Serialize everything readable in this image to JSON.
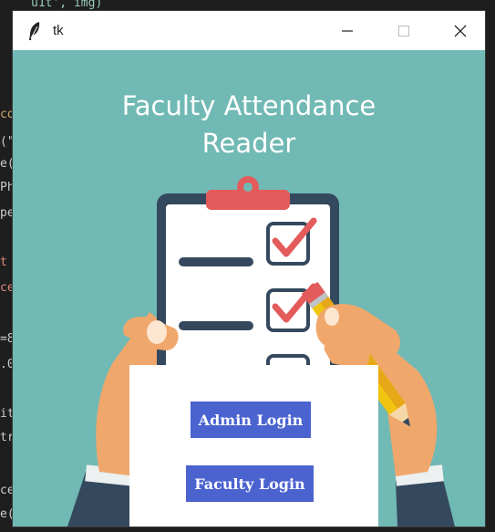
{
  "background": {
    "code_fragments": [
      "u1t', img)",
      "co",
      "(\"",
      "e(",
      "Ph",
      "pe",
      "t",
      "ce",
      "=8",
      ".0",
      "it",
      "tr",
      "ce",
      "e("
    ]
  },
  "window": {
    "title": "tk",
    "icon": "feather-icon",
    "controls": {
      "minimize_icon": "minimize-icon",
      "maximize_icon": "maximize-icon",
      "close_icon": "close-icon"
    }
  },
  "app": {
    "heading_line1": "Faculty Attendance",
    "heading_line2": "Reader",
    "admin_login_label": "Admin Login",
    "faculty_login_label": "Faculty Login"
  },
  "colors": {
    "background": "#71b9b4",
    "button": "#4b63cf",
    "checkmark": "#e35b5b",
    "clipboard": "#34495e"
  }
}
